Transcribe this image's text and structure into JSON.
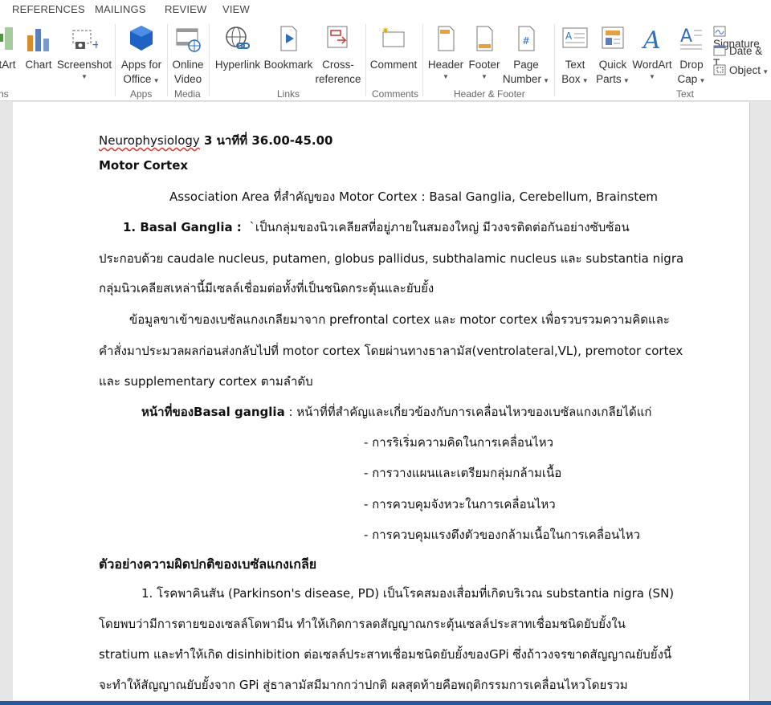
{
  "ribbon_tabs": [
    "REFERENCES",
    "MAILINGS",
    "REVIEW",
    "VIEW"
  ],
  "ribbon": {
    "smartart": "tArt",
    "chart": "Chart",
    "screenshot": "Screenshot",
    "apps_for_office": [
      "Apps for",
      "Office"
    ],
    "online_video": [
      "Online",
      "Video"
    ],
    "hyperlink": "Hyperlink",
    "bookmark": "Bookmark",
    "cross_reference": [
      "Cross-",
      "reference"
    ],
    "comment": "Comment",
    "header": "Header",
    "footer": "Footer",
    "page_number": [
      "Page",
      "Number"
    ],
    "text_box": [
      "Text",
      "Box"
    ],
    "quick_parts": [
      "Quick",
      "Parts"
    ],
    "wordart": "WordArt",
    "drop_cap": [
      "Drop",
      "Cap"
    ],
    "signature": "Signature",
    "date_time": "Date & T",
    "object": "Object",
    "groups": {
      "illustrations": "ns",
      "apps": "Apps",
      "media": "Media",
      "links": "Links",
      "comments": "Comments",
      "header_footer": "Header & Footer",
      "text": "Text"
    }
  },
  "document": {
    "title_word": "Neurophysiology",
    "title_rest": " 3  นาทีที่ 36.00-45.00",
    "heading1": "Motor Cortex",
    "assoc": "Association Area ที่สำคัญของ Motor Cortex : Basal Ganglia, Cerebellum, Brainstem",
    "bg_label": "1.  Basal  Ganglia  :",
    "bg_line1": "`เป็นกลุ่มของนิวเคลียสที่อยู่ภายในสมองใหญ่  มีวงจรติดต่อกันอย่างซับซ้อน",
    "bg_line2": "ประกอบด้วย caudale nucleus, putamen, globus pallidus, subthalamic nucleus และ substantia nigra",
    "bg_line3": "กลุ่มนิวเคลียสเหล่านี้มีเซลล์เชื่อมต่อทั้งที่เป็นชนิดกระตุ้นและยับยั้ง",
    "input_line1": "ข้อมูลขาเข้าของเบซัลแกงเกลียมาจาก prefrontal cortex และ motor  cortex เพื่อรวบรวมความคิดและ",
    "input_line2": "คำสั่งมาประมวลผลก่อนส่งกลับไปที่ motor cortex โดยผ่านทางธาลามัส(ventrolateral,VL), premotor cortex",
    "input_line3": "และ supplementary cortex ตามลำดับ",
    "func_label": "หน้าที่ของBasal ganglia",
    "func_rest": " : หน้าที่ที่สำคัญและเกี่ยวข้องกับการเคลื่อนไหวของเบซัลแกงเกลียได้แก่",
    "func_items": [
      "- การริเริ่มความคิดในการเคลื่อนไหว",
      "- การวางแผนและเตรียมกลุ่มกล้ามเนื้อ",
      "- การควบคุมจังหวะในการเคลื่อนไหว",
      "- การควบคุมแรงตึงตัวของกล้ามเนื้อในการเคลื่อนไหว"
    ],
    "heading2": "ตัวอย่างความผิดปกติของเบซัลแกงเกลีย",
    "pd_line1": "1. โรคพาคินสัน (Parkinson's disease, PD) เป็นโรคสมองเสื่อมที่เกิดบริเวณ substantia nigra (SN)",
    "pd_line2": "โดยพบว่ามีการตายของเซลล์โดพามีน        ทำให้เกิดการลดสัญญาณกระตุ้นเซลล์ประสาทเชื่อมชนิดยับยั้งใน",
    "pd_line3": "stratium และทำให้เกิด disinhibition ต่อเซลล์ประสาทเชื่อมชนิดยับยั้งของGPi ซึ่งถ้าวงจรขาดสัญญาณยับยั้งนี้",
    "pd_line4": "จะทำให้สัญญาณยับยั้งจาก  GPi  สู่ธาลามัสมีมากกว่าปกติ  ผลสุดท้ายคือพฤติกรรมการเคลื่อนไหวโดยรวม"
  }
}
